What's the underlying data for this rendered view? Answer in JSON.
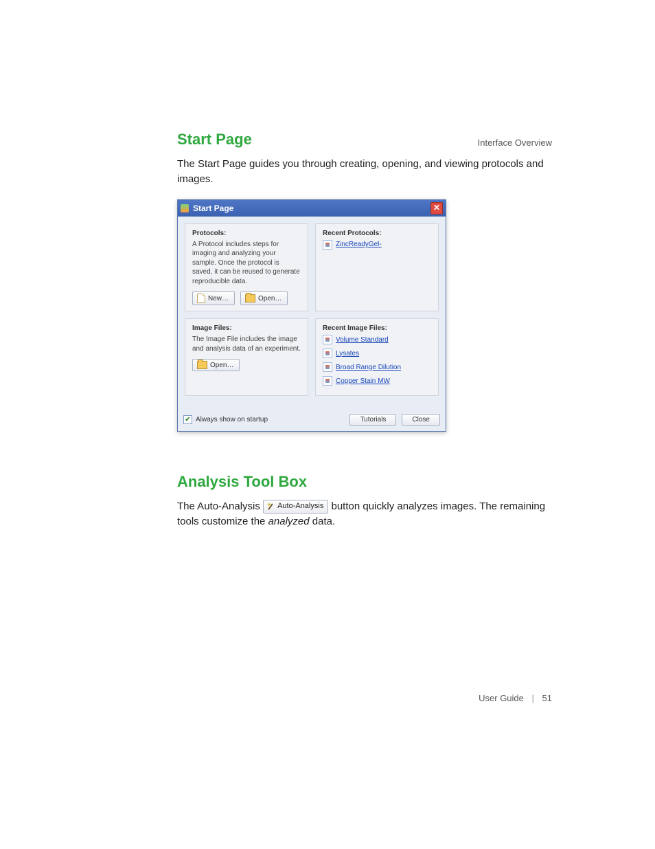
{
  "header": {
    "section": "Interface Overview"
  },
  "section1": {
    "heading": "Start Page",
    "intro": "The Start Page guides you through creating, opening, and viewing protocols and images."
  },
  "dialog": {
    "title": "Start Page",
    "protocols": {
      "title": "Protocols:",
      "desc": "A Protocol includes steps for imaging and analyzing your sample. Once the protocol is saved, it can be reused to generate reproducible data.",
      "newBtn": "New…",
      "openBtn": "Open…"
    },
    "recentProtocols": {
      "title": "Recent Protocols:",
      "items": [
        "ZincReadyGel-"
      ]
    },
    "imageFiles": {
      "title": "Image Files:",
      "desc": "The Image File includes the image and analysis data of an experiment.",
      "openBtn": "Open…"
    },
    "recentImageFiles": {
      "title": "Recent Image Files:",
      "items": [
        "Volume Standard",
        "Lysates",
        "Broad Range Dilution",
        "Copper Stain MW"
      ]
    },
    "footer": {
      "showStartup": "Always show on startup",
      "tutorials": "Tutorials",
      "close": "Close"
    }
  },
  "section2": {
    "heading": "Analysis Tool Box",
    "before": "The Auto-Analysis ",
    "btn": "Auto-Analysis",
    "after1": " button quickly analyzes images. The remaining tools customize the ",
    "italic": "analyzed",
    "after2": " data."
  },
  "pageFooter": {
    "guide": "User Guide",
    "page": "51"
  }
}
